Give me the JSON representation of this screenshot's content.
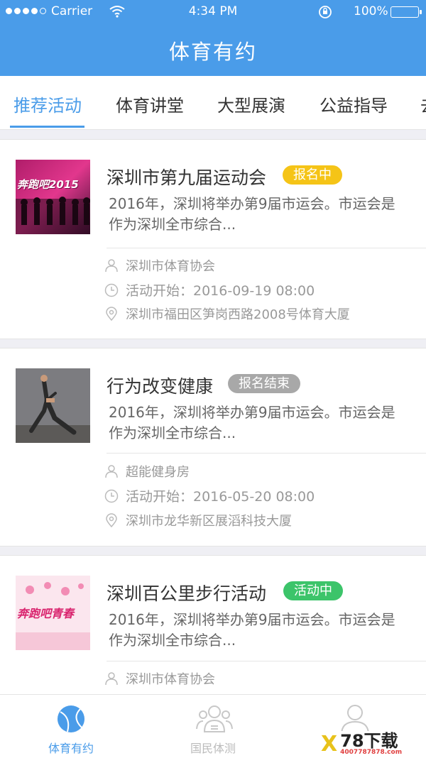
{
  "status_bar": {
    "carrier": "Carrier",
    "time": "4:34 PM",
    "battery": "100%"
  },
  "header": {
    "title": "体育有约"
  },
  "tabs": [
    {
      "label": "推荐活动"
    },
    {
      "label": "体育讲堂"
    },
    {
      "label": "大型展演"
    },
    {
      "label": "公益指导"
    },
    {
      "label": "去"
    }
  ],
  "activities": [
    {
      "title": "深圳市第九届运动会",
      "status": "报名中",
      "status_color": "#f5c417",
      "description": "2016年，深圳将举办第9届市运会。市运会是作为深圳全市综合...",
      "organizer": "深圳市体育协会",
      "start_time": "活动开始：2016-09-19  08:00",
      "location": "深圳市福田区笋岗西路2008号体育大厦",
      "thumb_text": "奔跑吧2015"
    },
    {
      "title": "行为改变健康",
      "status": "报名结束",
      "status_color": "#a8a8a8",
      "description": "2016年，深圳将举办第9届市运会。市运会是作为深圳全市综合...",
      "organizer": "超能健身房",
      "start_time": "活动开始：2016-05-20  08:00",
      "location": "深圳市龙华新区展滔科技大厦"
    },
    {
      "title": "深圳百公里步行活动",
      "status": "活动中",
      "status_color": "#3cc46a",
      "description": "2016年，深圳将举办第9届市运会。市运会是作为深圳全市综合...",
      "organizer": "深圳市体育协会",
      "thumb_text": "奔跑吧青春"
    }
  ],
  "bottom_nav": [
    {
      "label": "体育有约",
      "icon": "ball-icon"
    },
    {
      "label": "国民体测",
      "icon": "people-icon"
    },
    {
      "label": "",
      "icon": "user-icon"
    }
  ],
  "watermark": {
    "logo": "X",
    "main": "78下载",
    "sub": "4007787878.com"
  },
  "colors": {
    "primary": "#4a9ce9",
    "background": "#efeff4"
  }
}
